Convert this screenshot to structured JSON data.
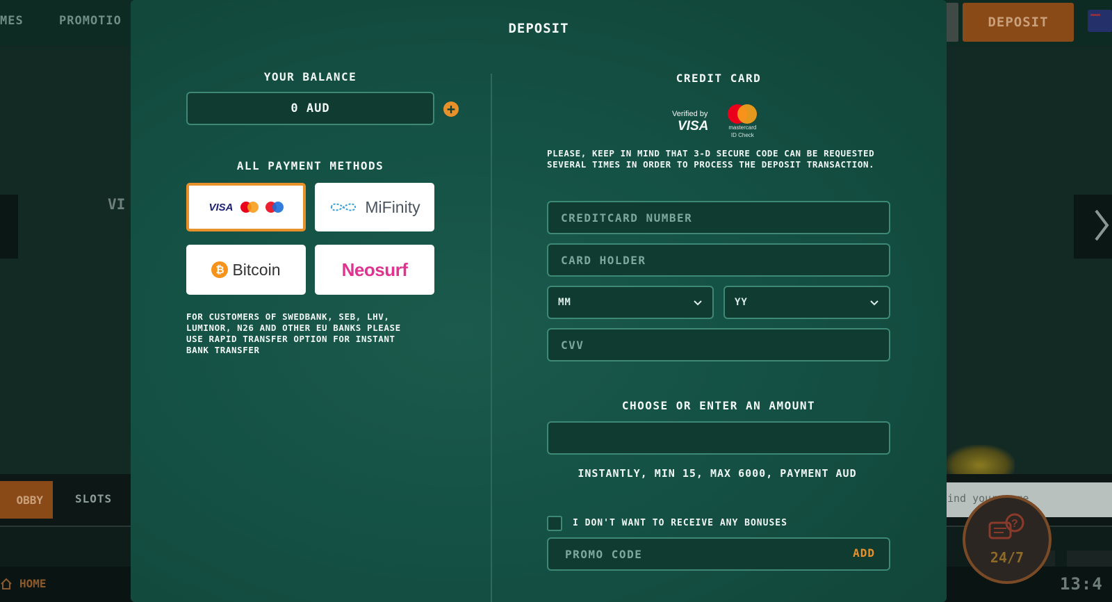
{
  "background": {
    "nav": [
      "MES",
      "PROMOTIO"
    ],
    "deposit_button": "DEPOSIT",
    "hero_text": "VI",
    "tabs": {
      "lobby": "OBBY",
      "slots": "SLOTS"
    },
    "search_placeholder": "ind your game",
    "home": "HOME",
    "time": "13:4",
    "support_label": "24/7"
  },
  "modal": {
    "title": "DEPOSIT",
    "balance": {
      "title": "YOUR BALANCE",
      "value": "0 AUD"
    },
    "payment_methods": {
      "title": "ALL PAYMENT METHODS",
      "methods": [
        {
          "id": "cards",
          "labels": [
            "VISA"
          ],
          "selected": true
        },
        {
          "id": "mifinity",
          "label": "MiFinity",
          "selected": false
        },
        {
          "id": "bitcoin",
          "label": "Bitcoin",
          "selected": false
        },
        {
          "id": "neosurf",
          "label": "Neosurf",
          "selected": false
        }
      ],
      "info": "FOR CUSTOMERS OF SWEDBANK, SEB, LHV, LUMINOR, N26 AND OTHER EU BANKS PLEASE USE RAPID TRANSFER OPTION FOR INSTANT BANK TRANSFER"
    },
    "credit_card": {
      "title": "CREDIT CARD",
      "verified_by": "Verified by",
      "visa": "VISA",
      "mastercard_small": "mastercard",
      "id_check": "ID Check",
      "notice": "PLEASE, KEEP IN MIND THAT 3-D SECURE CODE CAN BE REQUESTED SEVERAL TIMES IN ORDER TO PROCESS THE DEPOSIT TRANSACTION.",
      "number_placeholder": "CREDITCARD NUMBER",
      "holder_placeholder": "CARD HOLDER",
      "month": "MM",
      "year": "YY",
      "cvv_placeholder": "CVV"
    },
    "amount": {
      "title": "CHOOSE OR ENTER AN AMOUNT",
      "value": "",
      "hint": "INSTANTLY, MIN 15, MAX 6000, PAYMENT AUD"
    },
    "bonus_optout": {
      "label": "I DON'T WANT TO RECEIVE ANY BONUSES",
      "checked": false
    },
    "promo": {
      "placeholder": "PROMO CODE",
      "add_label": "ADD"
    }
  },
  "colors": {
    "accent": "#e8912a",
    "modal_bg": "#155246",
    "field_bg": "#0f3b31",
    "field_border": "#3e8876"
  },
  "icons": [
    "plus-icon",
    "chevron-down-icon",
    "bitcoin-icon",
    "mifinity-icon",
    "mastercard-icon",
    "maestro-icon",
    "home-icon",
    "support-chat-icon",
    "chevron-right-icon"
  ]
}
